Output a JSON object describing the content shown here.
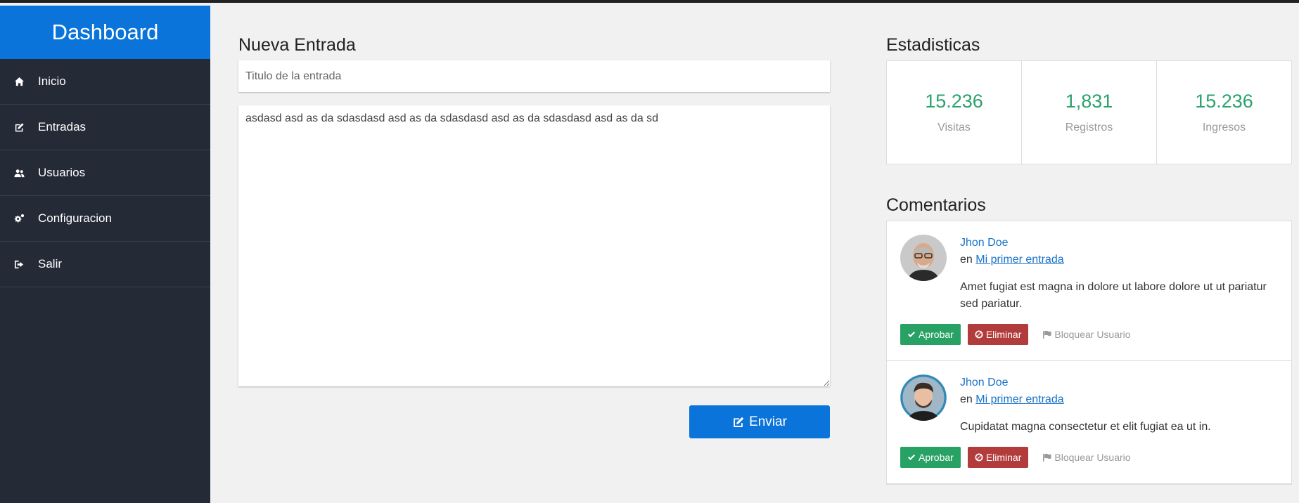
{
  "sidebar": {
    "brand": "Dashboard",
    "items": [
      {
        "label": "Inicio",
        "icon": "home-icon"
      },
      {
        "label": "Entradas",
        "icon": "edit-icon"
      },
      {
        "label": "Usuarios",
        "icon": "users-icon"
      },
      {
        "label": "Configuracion",
        "icon": "cogs-icon"
      },
      {
        "label": "Salir",
        "icon": "sign-out-icon"
      }
    ]
  },
  "new_entry": {
    "title": "Nueva Entrada",
    "title_placeholder": "Titulo de la entrada",
    "title_value": "",
    "body_value": "asdasd asd as da sdasdasd asd as da sdasdasd asd as da sdasdasd asd as da sd",
    "send_label": "Enviar"
  },
  "stats": {
    "title": "Estadisticas",
    "items": [
      {
        "value": "15.236",
        "label": "Visitas"
      },
      {
        "value": "1,831",
        "label": "Registros"
      },
      {
        "value": "15.236",
        "label": "Ingresos"
      }
    ]
  },
  "comments": {
    "title": "Comentarios",
    "approve_label": "Aprobar",
    "delete_label": "Eliminar",
    "block_label": "Bloquear Usuario",
    "connector": "en",
    "items": [
      {
        "author": "Jhon Doe",
        "post": "Mi primer entrada",
        "text": "Amet fugiat est magna in dolore ut labore dolore ut ut pariatur sed pariatur."
      },
      {
        "author": "Jhon Doe",
        "post": "Mi primer entrada",
        "text": "Cupidatat magna consectetur et elit fugiat ea ut in."
      }
    ]
  },
  "colors": {
    "primary": "#0a74da",
    "sidebar_bg": "#242a36",
    "success": "#28a264",
    "danger": "#b23b3b",
    "stat_value": "#2aa36b"
  }
}
